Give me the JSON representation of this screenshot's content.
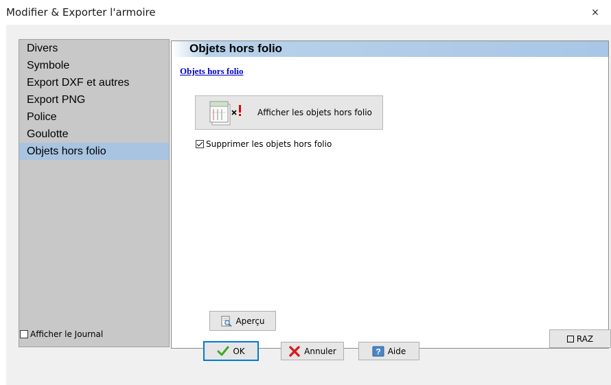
{
  "window": {
    "title": "Modifier & Exporter l'armoire",
    "close_glyph": "×"
  },
  "sidebar": {
    "items": [
      {
        "label": "Divers",
        "selected": false
      },
      {
        "label": "Symbole",
        "selected": false
      },
      {
        "label": "Export DXF et autres",
        "selected": false
      },
      {
        "label": "Export PNG",
        "selected": false
      },
      {
        "label": "Police",
        "selected": false
      },
      {
        "label": "Goulotte",
        "selected": false
      },
      {
        "label": "Objets hors folio",
        "selected": true
      }
    ],
    "journal": {
      "label": "Afficher le Journal",
      "checked": false
    }
  },
  "panel": {
    "header_title": "Objets hors folio",
    "section_link": "Objets hors folio",
    "show_button": {
      "label": "Afficher les objets hors folio",
      "icon": "folio-objects-icon"
    },
    "delete_checkbox": {
      "label": "Supprimer les objets hors folio",
      "checked": true
    },
    "preview_button": {
      "label": "Aperçu",
      "icon": "preview-icon"
    }
  },
  "footer": {
    "ok_label": "OK",
    "cancel_label": "Annuler",
    "help_label": "Aide",
    "raz_label": "RAZ"
  },
  "colors": {
    "selection": "#a9c4e1",
    "link": "#0000cc",
    "sidebar_bg": "#c8c8c8",
    "dialog_bg": "#f0f0f0",
    "ok_border": "#0078d7"
  }
}
